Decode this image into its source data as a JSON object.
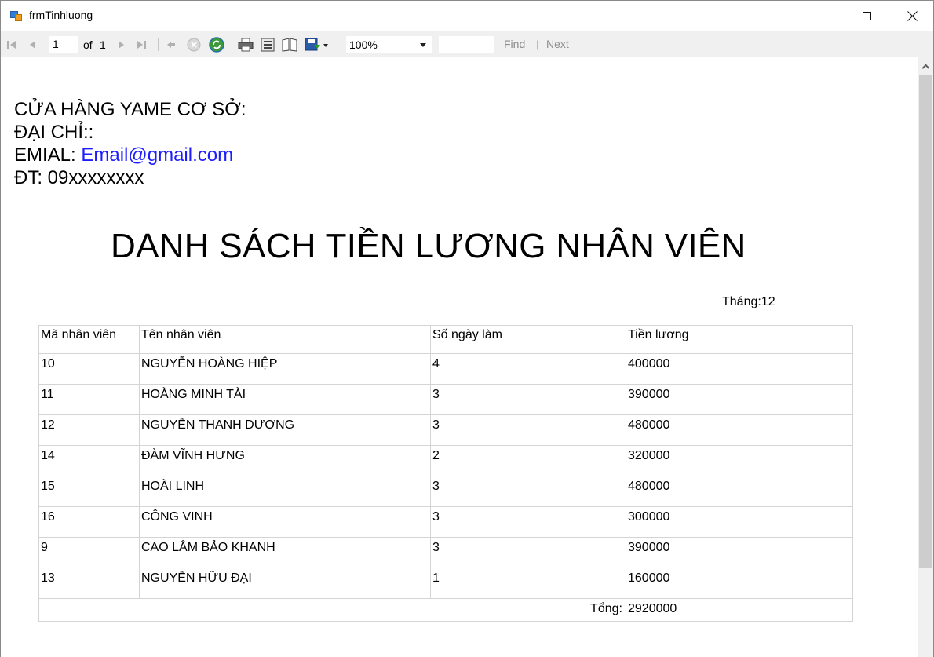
{
  "window": {
    "title": "frmTinhluong"
  },
  "toolbar": {
    "current_page": "1",
    "of_label": "of",
    "page_count": "1",
    "zoom": "100%",
    "find_label": "Find",
    "find_separator": "|",
    "next_label": "Next"
  },
  "report": {
    "shop_line": "CỬA HÀNG YAME CƠ SỞ:",
    "address_line": "ĐẠI CHỈ::",
    "email_prefix": "EMIAL: ",
    "email_value": "Email@gmail.com",
    "phone_line": "ĐT: 09xxxxxxxx",
    "title": "DANH SÁCH TIỀN LƯƠNG NHÂN VIÊN",
    "month": "Tháng:12",
    "columns": [
      "Mã nhân viên",
      "Tên nhân viên",
      "Số ngày làm",
      "Tiền lương"
    ],
    "rows": [
      [
        "10",
        "NGUYỄN HOÀNG HIỆP",
        "4",
        "400000"
      ],
      [
        "11",
        "HOÀNG MINH TÀI",
        "3",
        "390000"
      ],
      [
        "12",
        "NGUYỄN THANH DƯƠNG",
        "3",
        "480000"
      ],
      [
        "14",
        "ĐÀM VĨNH HƯNG",
        "2",
        "320000"
      ],
      [
        "15",
        "HOÀI LINH",
        "3",
        "480000"
      ],
      [
        "16",
        "CÔNG VINH",
        "3",
        "300000"
      ],
      [
        "9",
        "CAO LÂM BẢO KHANH",
        "3",
        "390000"
      ],
      [
        "13",
        "NGUYỄN HỮU ĐẠI",
        "1",
        "160000"
      ]
    ],
    "total_label": "Tổng:",
    "total_value": "2920000"
  }
}
